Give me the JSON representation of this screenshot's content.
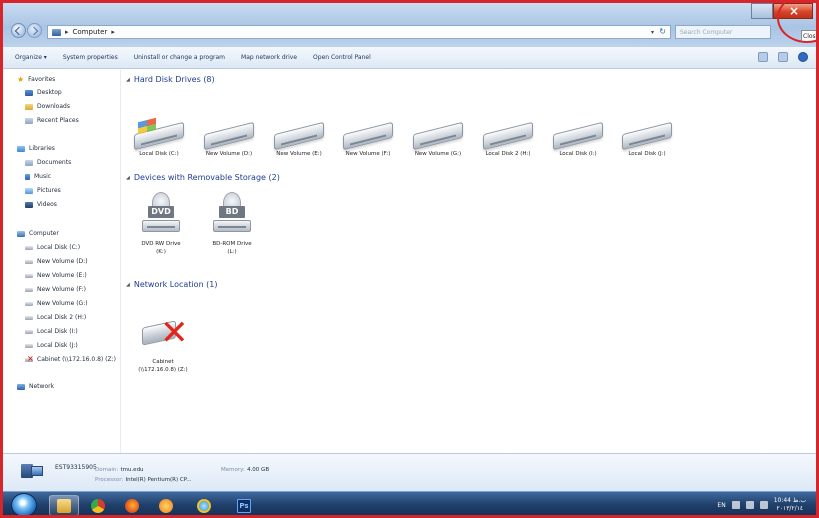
{
  "address": {
    "segments": [
      "Computer"
    ],
    "search_placeholder": "Search Computer"
  },
  "tooltip": "Close",
  "toolbar": [
    "Organize ▾",
    "System properties",
    "Uninstall or change a program",
    "Map network drive",
    "Open Control Panel"
  ],
  "nav": {
    "favorites": {
      "label": "Favorites",
      "items": [
        "Desktop",
        "Downloads",
        "Recent Places"
      ]
    },
    "libraries": {
      "label": "Libraries",
      "items": [
        "Documents",
        "Music",
        "Pictures",
        "Videos"
      ]
    },
    "computer": {
      "label": "Computer",
      "items": [
        "Local Disk (C:)",
        "New Volume (D:)",
        "New Volume (E:)",
        "New Volume (F:)",
        "New Volume (G:)",
        "Local Disk 2 (H:)",
        "Local Disk (I:)",
        "Local Disk (J:)",
        "Cabinet (\\\\172.16.0.8) (Z:)"
      ]
    },
    "network": {
      "label": "Network"
    }
  },
  "groups": {
    "hdd": {
      "title": "Hard Disk Drives (8)",
      "items": [
        "Local Disk (C:)",
        "New Volume (D:)",
        "New Volume (E:)",
        "New Volume (F:)",
        "New Volume (G:)",
        "Local Disk 2 (H:)",
        "Local Disk (I:)",
        "Local Disk (J:)"
      ]
    },
    "removable": {
      "title": "Devices with Removable Storage (2)",
      "items": [
        {
          "label1": "DVD RW Drive",
          "label2": "(K:)",
          "badge": "DVD"
        },
        {
          "label1": "BD-ROM Drive",
          "label2": "(L:)",
          "badge": "BD"
        }
      ]
    },
    "network": {
      "title": "Network Location (1)",
      "items": [
        {
          "label1": "Cabinet",
          "label2": "(\\\\172.16.0.8) (Z:)"
        }
      ]
    }
  },
  "details": {
    "name": "EST93315905",
    "domain_label": "Domain:",
    "domain_value": "tmu.edu",
    "memory_label": "Memory:",
    "memory_value": "4.00 GB",
    "processor_label": "Processor:",
    "processor_value": "Intel(R) Pentium(R) CP..."
  },
  "tray": {
    "lang": "EN",
    "time": "10:44 ب.ظ",
    "date": "۲۰۱۳/۲/۱٤"
  }
}
